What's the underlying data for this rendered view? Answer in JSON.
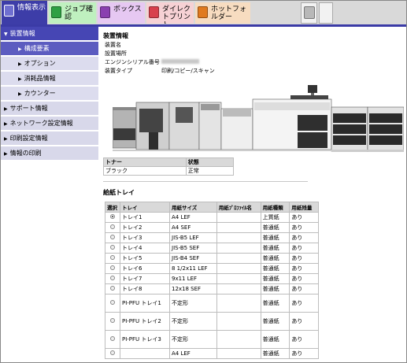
{
  "tabs": {
    "device_info": "情報表示",
    "job_check": "ジョブ確認",
    "box": "ボックス",
    "direct_print": "ダイレクトプリント",
    "hot_folder": "ホットフォルダー"
  },
  "sidebar": {
    "device_info": "装置情報",
    "configuration": "構成要素",
    "options": "オプション",
    "consumables": "消耗品情報",
    "counter": "カウンター",
    "support": "サポート情報",
    "network_settings": "ネットワーク設定情報",
    "print_settings": "印刷設定情報",
    "print_info": "情報の印刷"
  },
  "main": {
    "title": "装置情報",
    "device_name_label": "装置名",
    "location_label": "設置場所",
    "serial_label": "エンジンシリアル番号",
    "device_type_label": "装置タイプ",
    "device_type_value": "印刷/コピー/スキャン"
  },
  "toner": {
    "headers": [
      "トナー",
      "状態"
    ],
    "rows": [
      [
        "ブラック",
        "正常"
      ]
    ]
  },
  "tray": {
    "title": "給紙トレイ",
    "headers": [
      "選択",
      "トレイ",
      "用紙サイズ",
      "用紙ﾌﾟﾛﾌｧｲﾙ名",
      "用紙種類",
      "用紙残量"
    ],
    "rows": [
      [
        "トレイ1",
        "A4 LEF",
        "",
        "上質紙",
        "あり"
      ],
      [
        "トレイ2",
        "A4 SEF",
        "",
        "普通紙",
        "あり"
      ],
      [
        "トレイ3",
        "JIS-B5 LEF",
        "",
        "普通紙",
        "あり"
      ],
      [
        "トレイ4",
        "JIS-B5 SEF",
        "",
        "普通紙",
        "あり"
      ],
      [
        "トレイ5",
        "JIS-B4 SEF",
        "",
        "普通紙",
        "あり"
      ],
      [
        "トレイ6",
        "8 1/2x11 LEF",
        "",
        "普通紙",
        "あり"
      ],
      [
        "トレイ7",
        "9x11 LEF",
        "",
        "普通紙",
        "あり"
      ],
      [
        "トレイ8",
        "12x18 SEF",
        "",
        "普通紙",
        "あり"
      ],
      [
        "PI-PFU トレイ1",
        "不定形",
        "",
        "普通紙",
        "あり"
      ],
      [
        "PI-PFU トレイ2",
        "不定形",
        "",
        "普通紙",
        "あり"
      ],
      [
        "PI-PFU トレイ3",
        "不定形",
        "",
        "普通紙",
        "あり"
      ],
      [
        "",
        "A4 LEF",
        "",
        "普通紙",
        "あり"
      ]
    ]
  },
  "colors": {
    "header_blue": "#3d3da8",
    "sidebar_open": "#4646b4",
    "sidebar_item": "#d8d8ea"
  }
}
